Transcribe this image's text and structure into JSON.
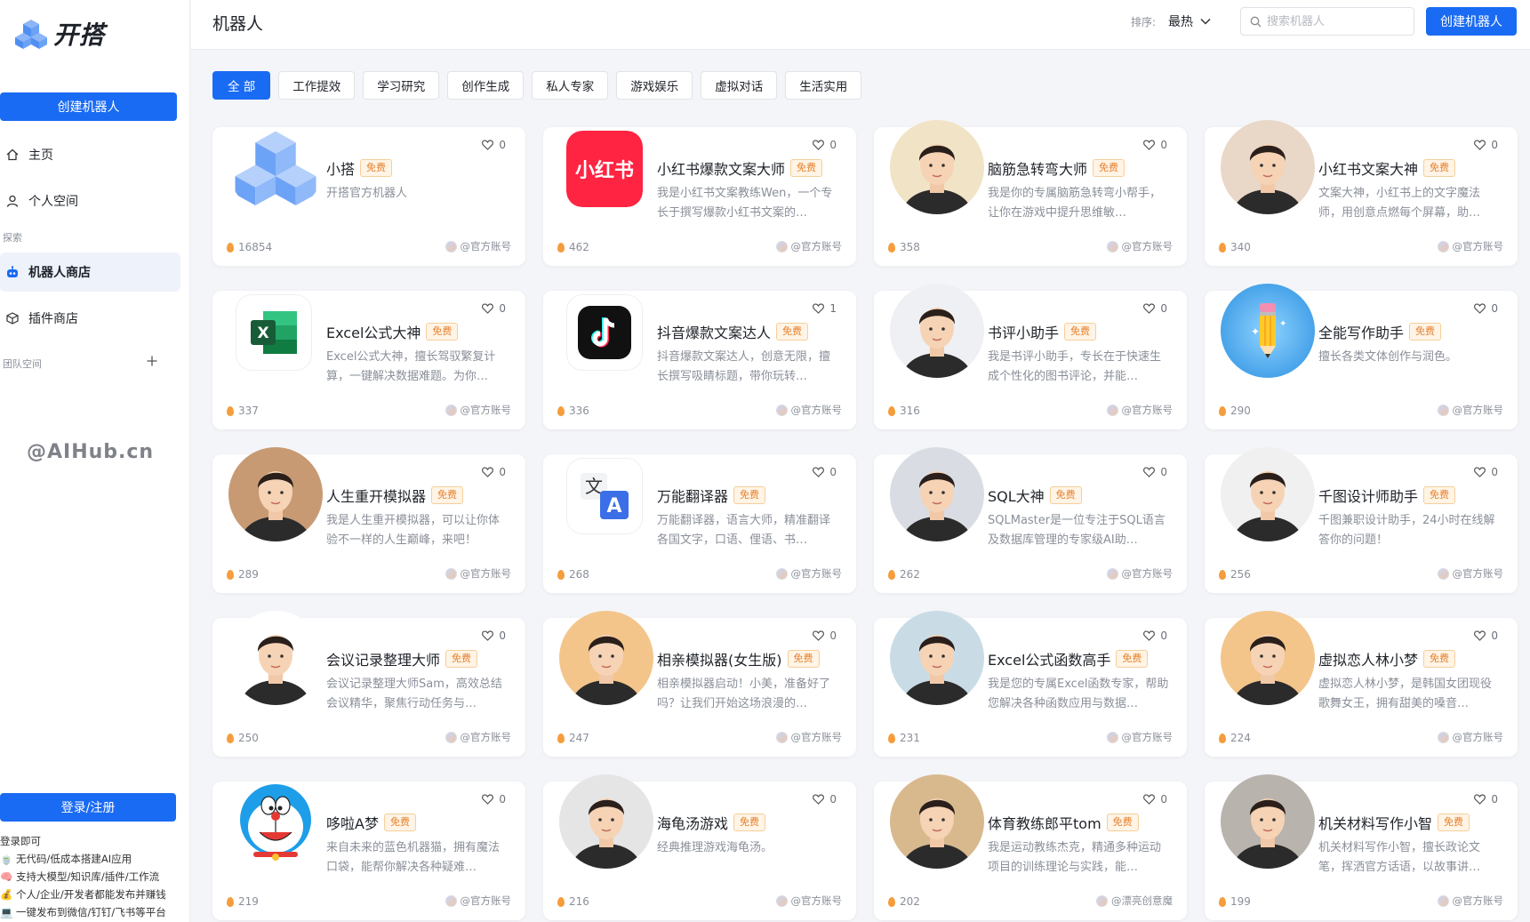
{
  "sidebar": {
    "logo_text": "开搭",
    "create_button": "创建机器人",
    "nav": [
      {
        "label": "主页",
        "icon": "home-icon"
      },
      {
        "label": "个人空间",
        "icon": "user-icon"
      }
    ],
    "explore_label": "探索",
    "explore_items": [
      {
        "label": "机器人商店",
        "icon": "robot-icon",
        "active": true
      },
      {
        "label": "插件商店",
        "icon": "cube-icon"
      }
    ],
    "team_label": "团队空间",
    "watermark": "@AIHub.cn",
    "login_button": "登录/注册",
    "promo_title": "登录即可",
    "promo_lines": [
      "无代码/低成本搭建AI应用",
      "支持大模型/知识库/插件/工作流",
      "个人/企业/开发者都能发布并赚钱",
      "一键发布到微信/钉钉/飞书等平台"
    ]
  },
  "header": {
    "title": "机器人",
    "sort_label": "排序:",
    "sort_value": "最热",
    "search_placeholder": "搜索机器人",
    "create_button": "创建机器人"
  },
  "tabs": [
    "全 部",
    "工作提效",
    "学习研究",
    "创作生成",
    "私人专家",
    "游戏娱乐",
    "虚拟对话",
    "生活实用"
  ],
  "free_label": "免费",
  "bots": [
    {
      "name": "小搭",
      "desc": "开搭官方机器人",
      "likes": "0",
      "uses": "16854",
      "author": "@官方账号",
      "avatar": "cubes",
      "bg": "#ffffff"
    },
    {
      "name": "小红书爆款文案大师",
      "desc": "我是小红书文案教练Wen，一个专长于撰写爆款小红书文案的…",
      "likes": "0",
      "uses": "462",
      "author": "@官方账号",
      "avatar": "xhs",
      "bg": "#ff2442"
    },
    {
      "name": "脑筋急转弯大师",
      "desc": "我是你的专属脑筋急转弯小帮手，让你在游戏中提升思维敏…",
      "likes": "0",
      "uses": "358",
      "author": "@官方账号",
      "avatar": "person",
      "bg": "#f1e3c6"
    },
    {
      "name": "小红书文案大神",
      "desc": "文案大神，小红书上的文字魔法师，用创意点燃每个屏幕，助…",
      "likes": "0",
      "uses": "340",
      "author": "@官方账号",
      "avatar": "person",
      "bg": "#e9d7c8"
    },
    {
      "name": "Excel公式大神",
      "desc": "Excel公式大神，擅长驾驭繁复计算，一键解决数据难题。为你…",
      "likes": "0",
      "uses": "337",
      "author": "@官方账号",
      "avatar": "excel",
      "bg": "#ffffff"
    },
    {
      "name": "抖音爆款文案达人",
      "desc": "抖音爆款文案达人，创意无限，擅长撰写吸睛标题，带你玩转…",
      "likes": "1",
      "uses": "336",
      "author": "@官方账号",
      "avatar": "douyin",
      "bg": "#ffffff"
    },
    {
      "name": "书评小助手",
      "desc": "我是书评小助手，专长在于快速生成个性化的图书评论，并能…",
      "likes": "0",
      "uses": "316",
      "author": "@官方账号",
      "avatar": "person",
      "bg": "#eef0f3"
    },
    {
      "name": "全能写作助手",
      "desc": "擅长各类文体创作与润色。",
      "likes": "0",
      "uses": "290",
      "author": "@官方账号",
      "avatar": "pencil",
      "bg": "#2a8fe0"
    },
    {
      "name": "人生重开模拟器",
      "desc": "我是人生重开模拟器，可以让你体验不一样的人生巅峰，来吧！",
      "likes": "0",
      "uses": "289",
      "author": "@官方账号",
      "avatar": "person",
      "bg": "#c79a74"
    },
    {
      "name": "万能翻译器",
      "desc": "万能翻译器，语言大师，精准翻译各国文字，口语、俚语、书…",
      "likes": "0",
      "uses": "268",
      "author": "@官方账号",
      "avatar": "translate",
      "bg": "#ffffff"
    },
    {
      "name": "SQL大神",
      "desc": "SQLMaster是一位专注于SQL语言及数据库管理的专家级AI助…",
      "likes": "0",
      "uses": "262",
      "author": "@官方账号",
      "avatar": "person",
      "bg": "#d9dde3"
    },
    {
      "name": "千图设计师助手",
      "desc": "千图兼职设计助手，24小时在线解答你的问题！",
      "likes": "0",
      "uses": "256",
      "author": "@官方账号",
      "avatar": "person",
      "bg": "#f0f0f0"
    },
    {
      "name": "会议记录整理大师",
      "desc": "会议记录整理大师Sam，高效总结会议精华，聚焦行动任务与…",
      "likes": "0",
      "uses": "250",
      "author": "@官方账号",
      "avatar": "person",
      "bg": "#ffffff"
    },
    {
      "name": "相亲模拟器(女生版)",
      "desc": "相亲模拟器启动！小美，准备好了吗？让我们开始这场浪漫的…",
      "likes": "0",
      "uses": "247",
      "author": "@官方账号",
      "avatar": "person",
      "bg": "#f3c58a"
    },
    {
      "name": "Excel公式函数高手",
      "desc": "我是您的专属Excel函数专家，帮助您解决各种函数应用与数据…",
      "likes": "0",
      "uses": "231",
      "author": "@官方账号",
      "avatar": "person",
      "bg": "#c9dce6"
    },
    {
      "name": "虚拟恋人林小梦",
      "desc": "虚拟恋人林小梦，是韩国女团现役歌舞女王，拥有甜美的嗓音…",
      "likes": "0",
      "uses": "224",
      "author": "@官方账号",
      "avatar": "person",
      "bg": "#f3c58a"
    },
    {
      "name": "哆啦A梦",
      "desc": "来自未来的蓝色机器猫，拥有魔法口袋，能帮你解决各种疑难…",
      "likes": "0",
      "uses": "219",
      "author": "@官方账号",
      "avatar": "doraemon",
      "bg": "#ffffff"
    },
    {
      "name": "海龟汤游戏",
      "desc": "经典推理游戏海龟汤。",
      "likes": "0",
      "uses": "216",
      "author": "@官方账号",
      "avatar": "person",
      "bg": "#e5e5e5"
    },
    {
      "name": "体育教练郎平tom",
      "desc": "我是运动教练杰克，精通多种运动项目的训练理论与实践，能…",
      "likes": "0",
      "uses": "202",
      "author": "@漂亮创意魔",
      "avatar": "person",
      "bg": "#d8b98e"
    },
    {
      "name": "机关材料写作小智",
      "desc": "机关材料写作小智，擅长政论文笔，挥洒官方话语，以故事讲…",
      "likes": "0",
      "uses": "199",
      "author": "@官方账号",
      "avatar": "person",
      "bg": "#b9b3ad"
    }
  ],
  "colors": {
    "accent": "#1a6bf3",
    "free": "#e6812f",
    "flame": "#f59d3c"
  }
}
